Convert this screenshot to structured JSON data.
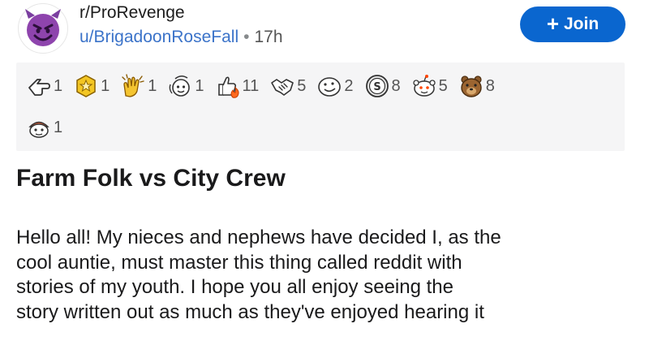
{
  "post": {
    "subreddit": "r/ProRevenge",
    "username": "u/BrigadoonRoseFall",
    "separator": "•",
    "time": "17h",
    "join_label": "Join",
    "join_icon": "plus-icon"
  },
  "awards": [
    {
      "icon": "hand-pointing-award-icon",
      "count": "1"
    },
    {
      "icon": "star-badge-award-icon",
      "count": "1"
    },
    {
      "icon": "clapping-hands-award-icon",
      "count": "1"
    },
    {
      "icon": "spinning-face-award-icon",
      "count": "1"
    },
    {
      "icon": "thumbs-up-fire-award-icon",
      "count": "11"
    },
    {
      "icon": "handshake-award-icon",
      "count": "5"
    },
    {
      "icon": "smiling-face-award-icon",
      "count": "2"
    },
    {
      "icon": "silver-coin-award-icon",
      "count": "8"
    },
    {
      "icon": "snoo-face-award-icon",
      "count": "5"
    },
    {
      "icon": "bear-award-icon",
      "count": "8"
    },
    {
      "icon": "helmet-snoo-award-icon",
      "count": "1"
    }
  ],
  "title": "Farm Folk vs City Crew",
  "body_lines": [
    "Hello all! My nieces and nephews have decided I, as the",
    "cool auntie, must master this thing called reddit with",
    "stories of my youth. I hope you all enjoy seeing the",
    "story written out as much as they've enjoyed hearing it"
  ],
  "colors": {
    "join_button": "#0a66cf",
    "username": "#3b73c9",
    "award_panel": "#f5f5f6",
    "avatar": "#8e44ad"
  }
}
